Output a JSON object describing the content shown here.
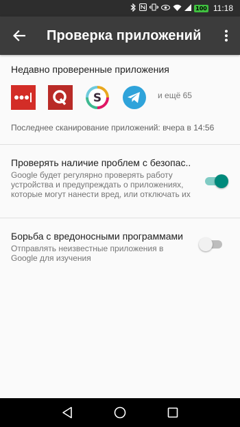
{
  "status_bar": {
    "time": "11:18",
    "battery_level": "100",
    "icons": [
      "bluetooth-icon",
      "nfc-icon",
      "vibrate-icon",
      "eye-comfort-icon",
      "wifi-icon",
      "cellular-signal-icon",
      "battery-icon"
    ]
  },
  "app_bar": {
    "title": "Проверка приложений",
    "back_icon": "arrow-back-icon",
    "menu_icon": "more-vert-icon",
    "background": "#3c3c3c"
  },
  "recent": {
    "title": "Недавно проверенные приложения",
    "apps": [
      {
        "name": "lastpass",
        "color": "#d32d27"
      },
      {
        "name": "quora",
        "color": "#b92b27"
      },
      {
        "name": "slack",
        "color": "#ffffff"
      },
      {
        "name": "telegram",
        "color": "#2fa3da"
      }
    ],
    "more": "и ещё 65",
    "last_scan": "Последнее сканирование приложений: вчера в 14:56"
  },
  "settings": [
    {
      "title": "Проверять наличие проблем с безопас..",
      "summary": "Google будет регулярно проверять работу устройства и предупреждать о приложениях, которые могут нанести вред, или отключать их",
      "enabled": true
    },
    {
      "title": "Борьба с вредоносными программами",
      "summary": "Отправлять неизвестные приложения в Google для изучения",
      "enabled": false
    }
  ],
  "accent_color": "#00897b",
  "nav_bar": {
    "buttons": [
      "back-triangle-icon",
      "home-circle-icon",
      "recents-square-icon"
    ]
  }
}
